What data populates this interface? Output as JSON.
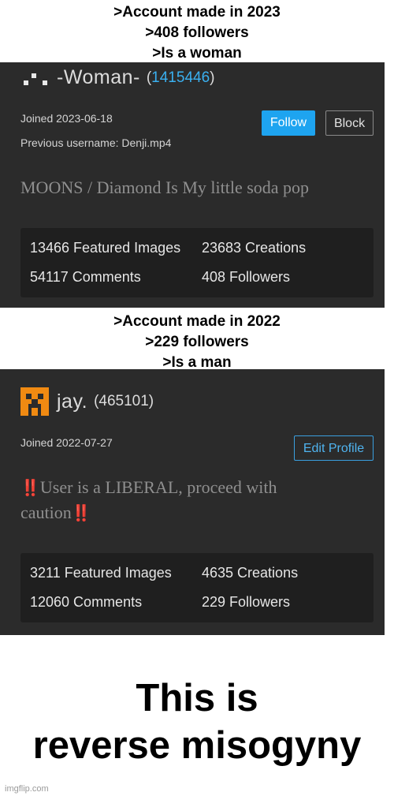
{
  "top_caption": {
    "lines": [
      ">Account made in 2023",
      ">408 followers",
      ">Is a woman"
    ]
  },
  "profile1": {
    "username": "-Woman-",
    "user_id": "1415446",
    "joined": "Joined 2023-06-18",
    "previous_username": "Previous username: Denji.mp4",
    "follow_label": "Follow",
    "block_label": "Block",
    "bio": "MOONS / Diamond Is My little soda pop",
    "stats": {
      "featured": "13466 Featured Images",
      "creations": "23683 Creations",
      "comments": "54117 Comments",
      "followers": "408 Followers"
    },
    "colors": {
      "id_link": "#3ab0f0",
      "follow_button": "#1ea4f0"
    }
  },
  "middle_caption": {
    "lines": [
      ">Account made in 2022",
      ">229 followers",
      ">Is a man"
    ]
  },
  "profile2": {
    "username": "jay.",
    "user_id": "(465101)",
    "joined": "Joined 2022-07-27",
    "edit_label": "Edit Profile",
    "bio_emoji": "‼️",
    "bio_line1": "User is a LIBERAL, proceed with",
    "bio_line2": "caution",
    "stats": {
      "featured": "3211 Featured Images",
      "creations": "4635 Creations",
      "comments": "12060 Comments",
      "followers": "229 Followers"
    },
    "colors": {
      "avatar": "#f08a12",
      "emoji": "#e02020"
    }
  },
  "bottom_text": {
    "line1": "This is",
    "line2": "reverse misogyny"
  },
  "watermark": "imgflip.com"
}
